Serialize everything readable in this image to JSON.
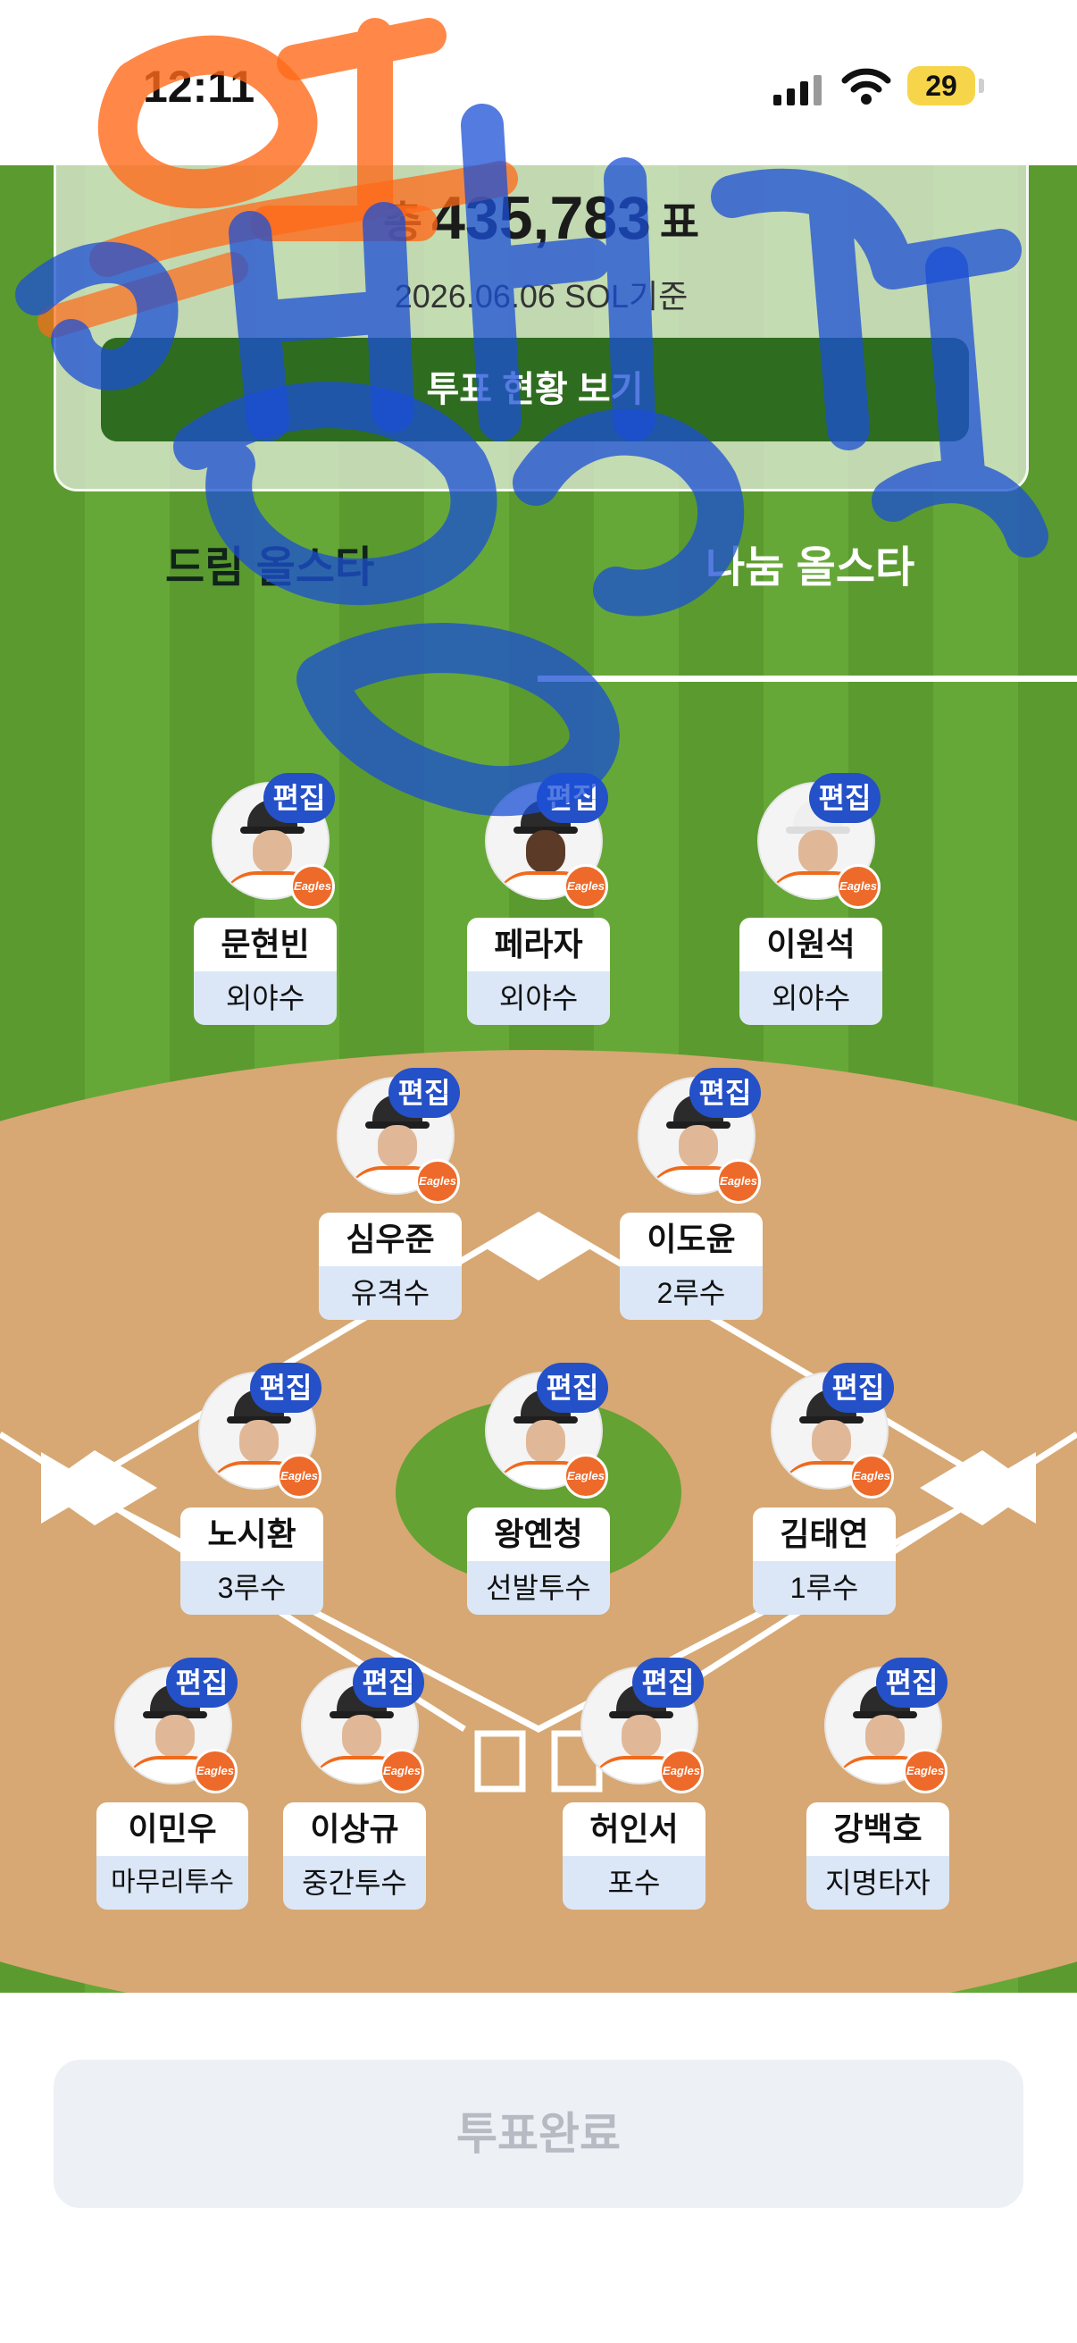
{
  "status_bar": {
    "time": "12:11",
    "battery": "29"
  },
  "vote_summary": {
    "prefix": "총",
    "total": "435,783",
    "suffix": "표",
    "date_basis": "2026.06.06 SOL기준",
    "status_button": "투표 현황 보기"
  },
  "tabs": [
    {
      "label": "드림 올스타",
      "selected": false
    },
    {
      "label": "나눔 올스타",
      "selected": true
    }
  ],
  "edit_label": "편집",
  "team_logo": "Eagles",
  "players": [
    {
      "name": "문현빈",
      "position": "외야수"
    },
    {
      "name": "페라자",
      "position": "외야수"
    },
    {
      "name": "이원석",
      "position": "외야수"
    },
    {
      "name": "심우준",
      "position": "유격수"
    },
    {
      "name": "이도윤",
      "position": "2루수"
    },
    {
      "name": "노시환",
      "position": "3루수"
    },
    {
      "name": "왕옌청",
      "position": "선발투수"
    },
    {
      "name": "김태연",
      "position": "1루수"
    },
    {
      "name": "이민우",
      "position": "마무리투수"
    },
    {
      "name": "이상규",
      "position": "중간투수"
    },
    {
      "name": "허인서",
      "position": "포수"
    },
    {
      "name": "강백호",
      "position": "지명타자"
    }
  ],
  "submit_button": "투표완료",
  "colors": {
    "accent_blue": "#2450c8",
    "field_green": "#5b9a2f",
    "dirt": "#d7a873",
    "logo_orange": "#ee6a2a"
  }
}
